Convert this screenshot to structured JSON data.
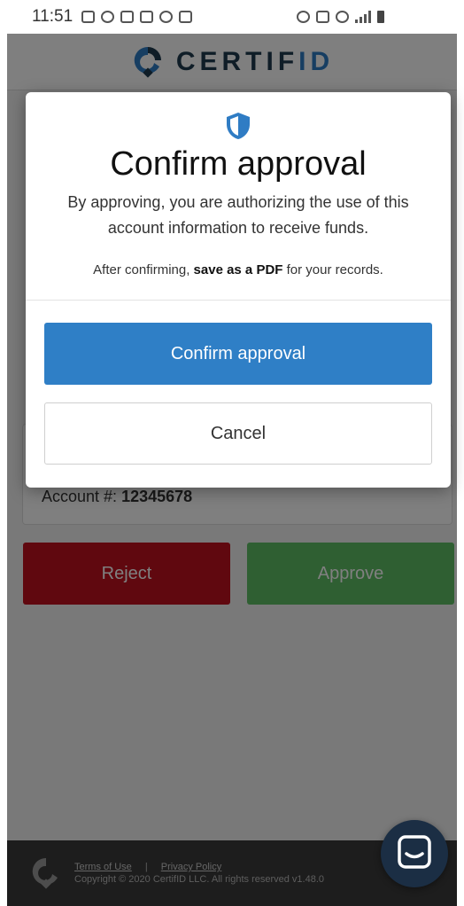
{
  "status_bar": {
    "time": "11:51"
  },
  "brand": {
    "name_main": "CERTIF",
    "name_accent": "ID",
    "primary_color": "#1f3a4f",
    "accent_color": "#2f7cc4"
  },
  "account": {
    "label": "Account #:",
    "number": "12345678"
  },
  "actions": {
    "reject_label": "Reject",
    "approve_label": "Approve",
    "reject_color": "#c0101e",
    "approve_color": "#5fbf64"
  },
  "modal": {
    "title": "Confirm approval",
    "body": "By approving, you are authorizing the use of this account information to receive funds.",
    "note_prefix": "After confirming, ",
    "note_bold": "save as a PDF",
    "note_suffix": " for your records.",
    "confirm_label": "Confirm approval",
    "cancel_label": "Cancel",
    "confirm_color": "#2f7fc6",
    "icon": "shield-icon"
  },
  "footer": {
    "terms_label": "Terms of Use",
    "separator": "|",
    "privacy_label": "Privacy Policy",
    "copyright": "Copyright © 2020 CertifID LLC. All rights reserved v1.48.0"
  },
  "chat": {
    "icon": "chat-icon"
  }
}
